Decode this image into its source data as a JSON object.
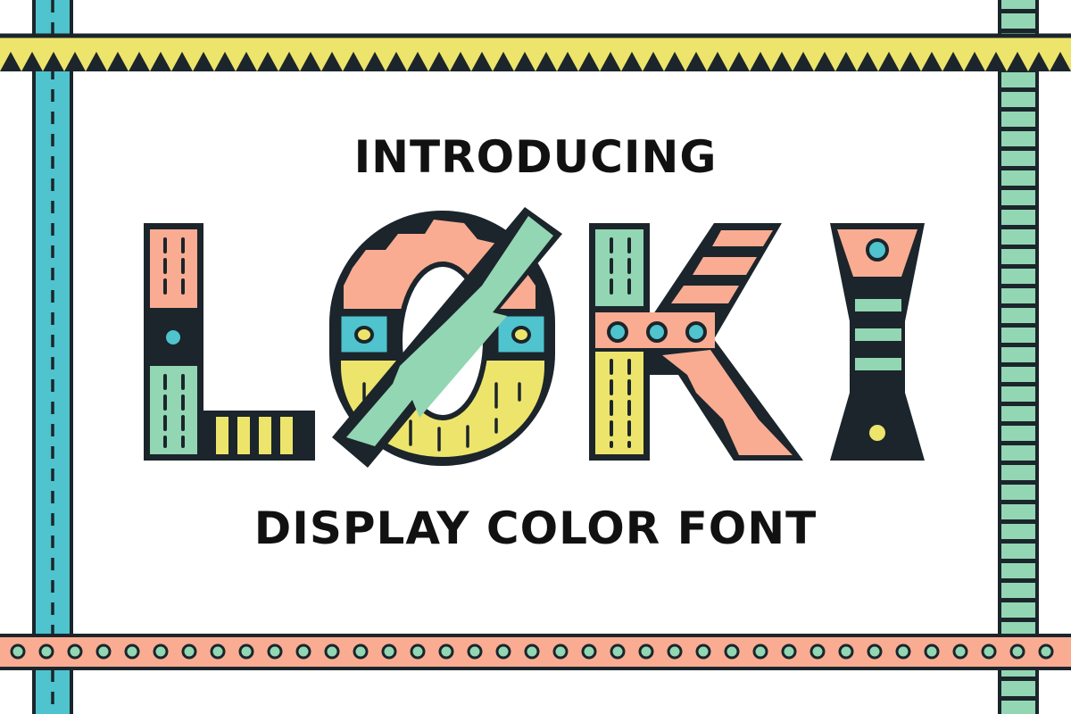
{
  "headline": {
    "intro": "INTRODUCING",
    "subtitle": "DISPLAY COLOR FONT"
  },
  "logo": {
    "word": "LØKI"
  },
  "colors": {
    "outline": "#1b252b",
    "salmon": "#f9ac92",
    "mint": "#93d6b3",
    "yellow": "#ede46c",
    "cyan": "#4fc3ce",
    "background": "#ffffff"
  }
}
